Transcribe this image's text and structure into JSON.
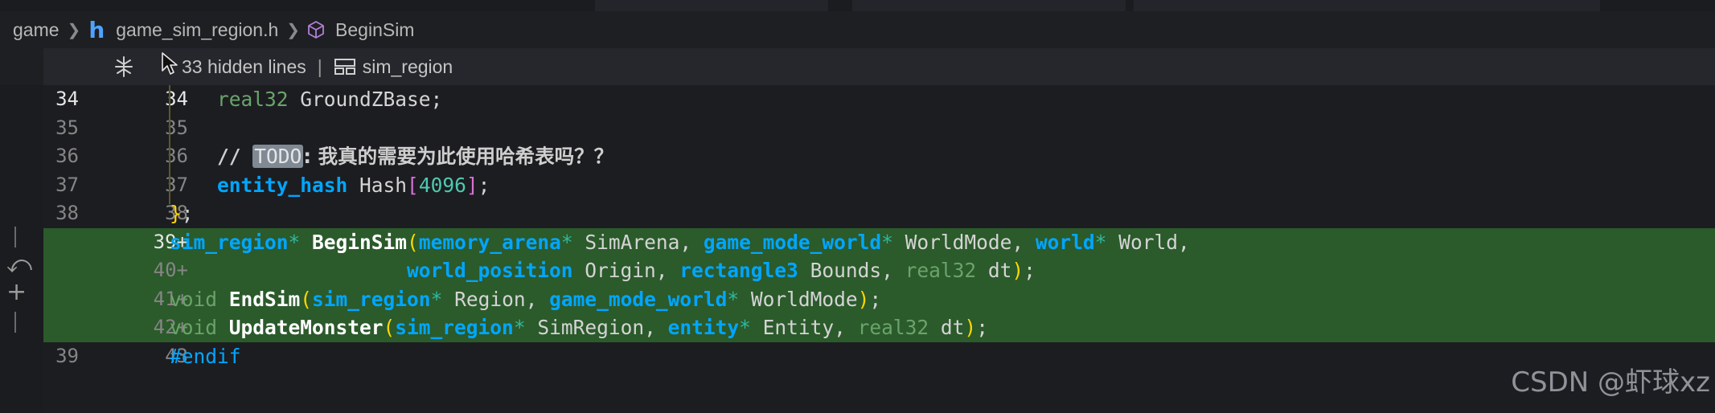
{
  "breadcrumb": {
    "items": [
      {
        "label": "game"
      },
      {
        "label": "game_sim_region.h",
        "icon": "h-file-icon"
      },
      {
        "label": "BeginSim",
        "icon": "cube-icon"
      }
    ]
  },
  "sticky": {
    "hidden_lines": "33 hidden lines",
    "separator": "|",
    "region": "sim_region"
  },
  "colors": {
    "added_line_bg": "#2b5a2b",
    "type_keyword": "#00a6ff",
    "background": "#1e1f22"
  },
  "gutter": {
    "controls": [
      "revert-icon",
      "plus-icon"
    ]
  },
  "lines": [
    {
      "left": "34",
      "right": "34",
      "active": true
    },
    {
      "left": "35",
      "right": "35"
    },
    {
      "left": "36",
      "right": "36"
    },
    {
      "left": "37",
      "right": "37"
    },
    {
      "left": "38",
      "right": "38"
    },
    {
      "left": "",
      "right": "39+",
      "added": true,
      "active": true
    },
    {
      "left": "",
      "right": "40+",
      "added": true
    },
    {
      "left": "",
      "right": "41+",
      "added": true
    },
    {
      "left": "",
      "right": "42+",
      "added": true
    },
    {
      "left": "39",
      "right": "43"
    }
  ],
  "code": {
    "l34": {
      "indent": "    ",
      "type": "real32",
      "rest": " GroundZBase;"
    },
    "l36": {
      "indent": "    ",
      "slashes": "// ",
      "todo": "TODO",
      "text": ": 我真的需要为此使用哈希表吗？？"
    },
    "l37": {
      "indent": "    ",
      "type": "entity_hash",
      "name": " Hash",
      "open": "[",
      "num": "4096",
      "close": "]",
      "semi": ";"
    },
    "l38": {
      "brace": "}",
      "semi": ";"
    },
    "l39": {
      "t1": "sim_region",
      "p1": "*",
      "fn": " BeginSim",
      "open": "(",
      "t2": "memory_arena",
      "p2": "*",
      "a2": " SimArena, ",
      "t3": "game_mode_world",
      "p3": "*",
      "a3": " WorldMode, ",
      "t4": "world",
      "p4": "*",
      "a4": " World,"
    },
    "l40": {
      "indent": "                    ",
      "t1": "world_position",
      "a1": " Origin, ",
      "t2": "rectangle3",
      "a2": " Bounds, ",
      "t3": "real32",
      "a3": " dt",
      "close": ")",
      "semi": ";"
    },
    "l41": {
      "t0": "void",
      "fn": " EndSim",
      "open": "(",
      "t1": "sim_region",
      "p1": "*",
      "a1": " Region, ",
      "t2": "game_mode_world",
      "p2": "*",
      "a2": " WorldMode",
      "close": ")",
      "semi": ";"
    },
    "l42": {
      "t0": "void",
      "fn": " UpdateMonster",
      "open": "(",
      "t1": "sim_region",
      "p1": "*",
      "a1": " SimRegion, ",
      "t2": "entity",
      "p2": "*",
      "a2": " Entity, ",
      "t3": "real32",
      "a3": " dt",
      "close": ")",
      "semi": ";"
    },
    "l43": {
      "directive": "#endif"
    }
  },
  "watermark": "CSDN @虾球xz"
}
